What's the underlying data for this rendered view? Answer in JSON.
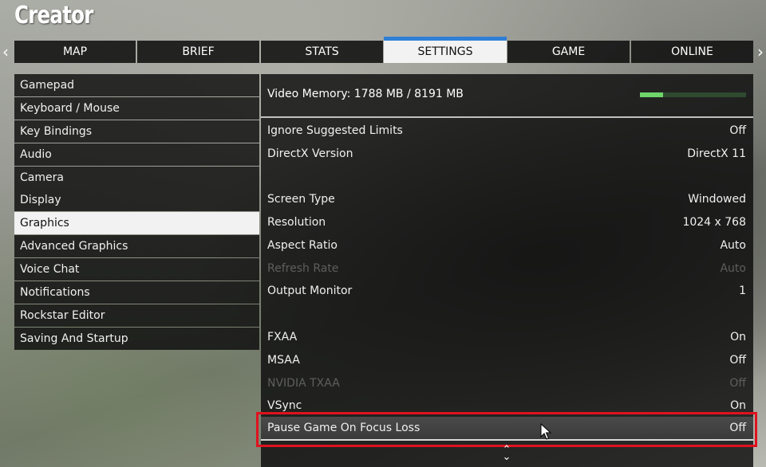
{
  "header": {
    "title": "Creator"
  },
  "nav": {
    "prev_icon": "chevron-left-icon",
    "next_icon": "chevron-right-icon"
  },
  "tabs": [
    {
      "label": "MAP",
      "active": false
    },
    {
      "label": "BRIEF",
      "active": false
    },
    {
      "label": "STATS",
      "active": false
    },
    {
      "label": "SETTINGS",
      "active": true
    },
    {
      "label": "GAME",
      "active": false
    },
    {
      "label": "ONLINE",
      "active": false
    }
  ],
  "menu": [
    {
      "label": "Gamepad"
    },
    {
      "label": "Keyboard / Mouse"
    },
    {
      "label": "Key Bindings"
    },
    {
      "label": "Audio"
    },
    {
      "label": "Camera"
    },
    {
      "label": "Display"
    },
    {
      "label": "Graphics",
      "active": true
    },
    {
      "label": "Advanced Graphics"
    },
    {
      "label": "Voice Chat"
    },
    {
      "label": "Notifications"
    },
    {
      "label": "Rockstar Editor"
    },
    {
      "label": "Saving And Startup"
    }
  ],
  "video_memory": {
    "label": "Video Memory: 1788 MB / 8191 MB",
    "used_fraction": 0.218,
    "bar_color": "#6fd46a"
  },
  "settings": [
    {
      "label": "Ignore Suggested Limits",
      "value": "Off"
    },
    {
      "label": "DirectX Version",
      "value": "DirectX 11"
    },
    {
      "label": "Screen Type",
      "value": "Windowed"
    },
    {
      "label": "Resolution",
      "value": "1024 x 768"
    },
    {
      "label": "Aspect Ratio",
      "value": "Auto"
    },
    {
      "label": "Refresh Rate",
      "value": "Auto",
      "disabled": true
    },
    {
      "label": "Output Monitor",
      "value": "1"
    },
    {
      "label": "FXAA",
      "value": "On"
    },
    {
      "label": "MSAA",
      "value": "Off"
    },
    {
      "label": "NVIDIA TXAA",
      "value": "Off",
      "disabled": true
    },
    {
      "label": "VSync",
      "value": "On"
    },
    {
      "label": "Pause Game On Focus Loss",
      "value": "Off",
      "hovered": true
    }
  ],
  "scroll_icon": "scroll-down-icon",
  "colors": {
    "tab_accent": "#2f7fd6",
    "highlight_box": "#e0121e"
  }
}
